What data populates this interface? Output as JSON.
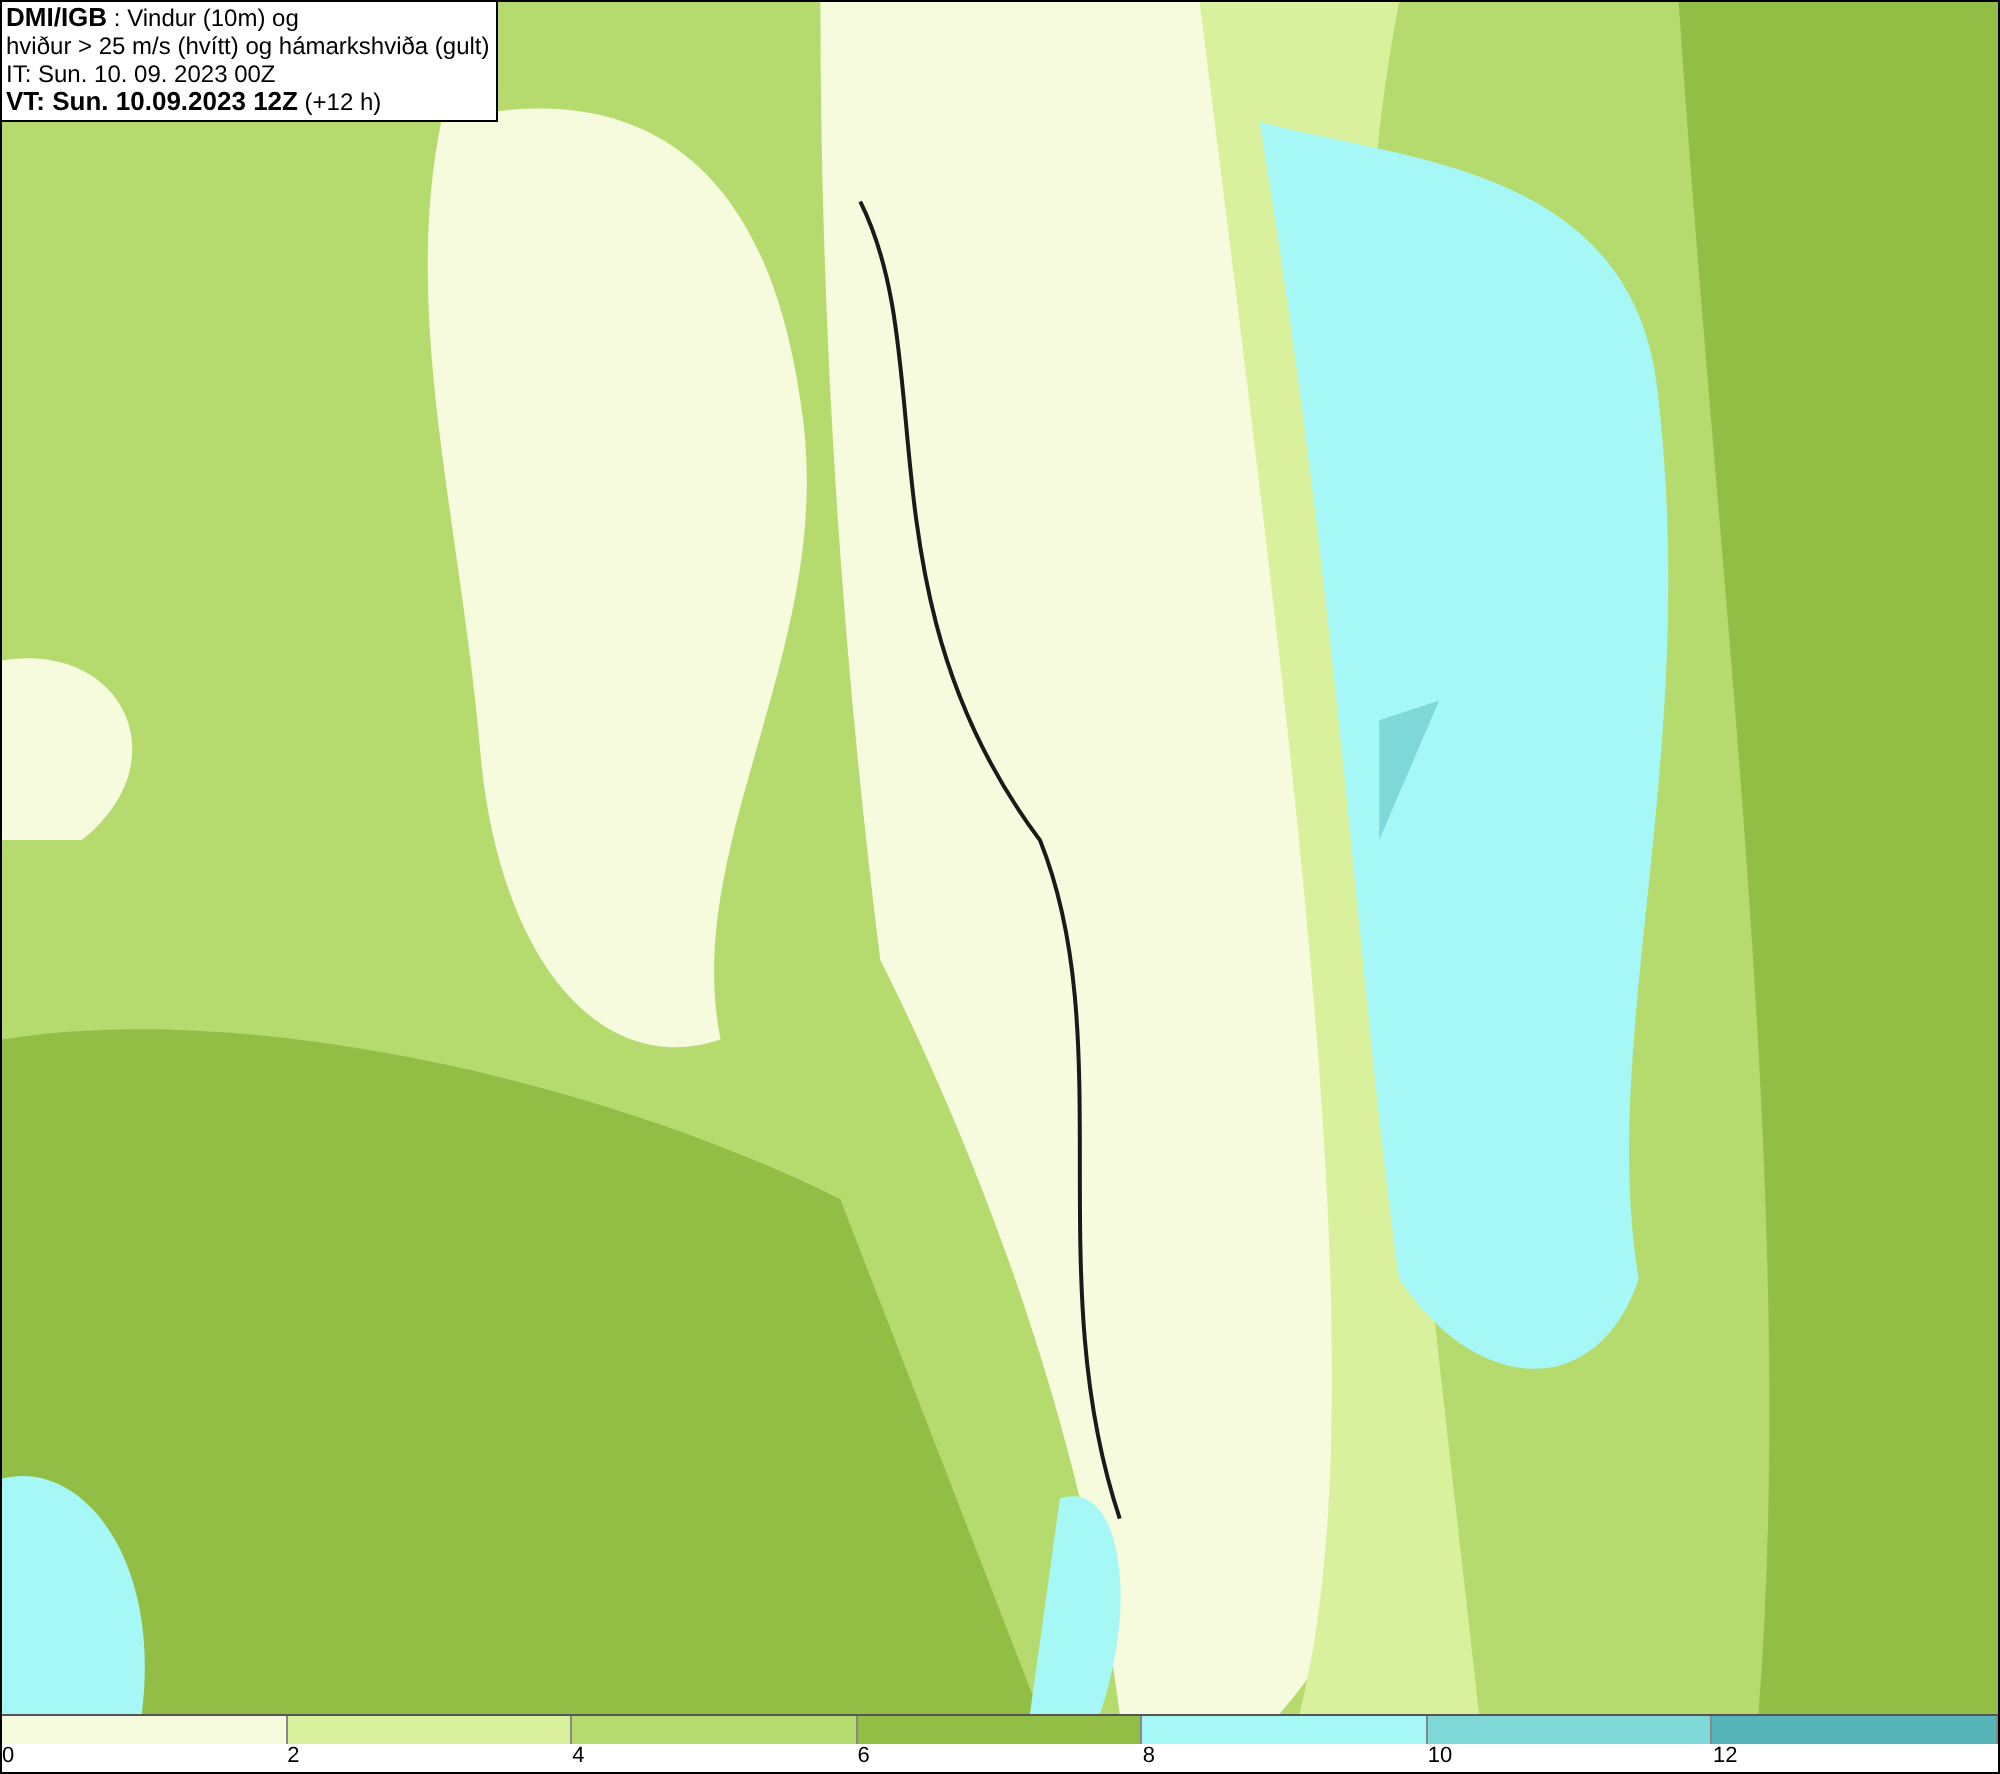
{
  "title_box": {
    "lines": [
      "**DMI/IGB** : Vindur (10m) og",
      "hviður > 25 m/s (hvítt) og hámarkshviða (gult)",
      "IT: Sun. 10. 09. 2023 00Z",
      "**VT: Sun. 10.09.2023 12Z** (+12 h)"
    ]
  },
  "legend": [
    {
      "color": "#f5fbdc",
      "label": "0"
    },
    {
      "color": "#d9f09c",
      "label": "2"
    },
    {
      "color": "#b5db6e",
      "label": "4"
    },
    {
      "color": "#93be45",
      "label": "6"
    },
    {
      "color": "#a6f8f7",
      "label": "8"
    },
    {
      "color": "#7fd8d8",
      "label": "10"
    },
    {
      "color": "#56b5b8",
      "label": "12"
    }
  ]
}
